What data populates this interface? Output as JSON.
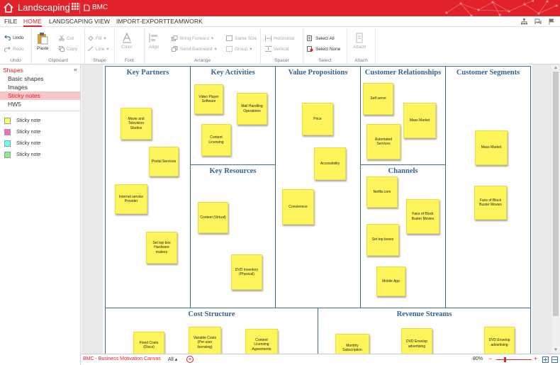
{
  "app": {
    "title": "Landscaping",
    "document": "BMC"
  },
  "menu": {
    "tabs": [
      "FILE",
      "HOME",
      "LANDSCAPING",
      "VIEW",
      "IMPORT-EXPORT",
      "TEAMWORK"
    ],
    "active": "HOME"
  },
  "ribbon": {
    "undo": "Undo",
    "redo": "Redo",
    "undo_group": "Undo",
    "paste": "Paste",
    "cut": "Cut",
    "copy": "Copy",
    "clipboard_group": "Clipboard",
    "fill": "Fill",
    "line": "Line",
    "shape_group": "Shape",
    "color": "Color",
    "font_group": "Font",
    "align": "Align",
    "bring_forward": "Bring Forward",
    "send_backward": "Send Backward",
    "same_size": "Same Size",
    "group": "Group",
    "arrange_group": "Arrange",
    "horizontal": "Horizontal",
    "vertical": "Vertical",
    "spacer_group": "Spacer",
    "select_all": "Select All",
    "select_none": "Select None",
    "select_group": "Select",
    "attach": "Attach",
    "attach_group": "Attach"
  },
  "sidebar": {
    "header": "Shapes",
    "collapse": "«",
    "categories": [
      "Basic shapes",
      "Images",
      "Sticky notes",
      "HW5"
    ],
    "selected": "Sticky notes",
    "items": [
      {
        "label": "Sticky note",
        "color": "#ffff66"
      },
      {
        "label": "Sticky note",
        "color": "#ff66cc"
      },
      {
        "label": "Sticky note",
        "color": "#66ffff"
      },
      {
        "label": "Sticky note",
        "color": "#88ee88"
      }
    ]
  },
  "canvas": {
    "titles": {
      "partners": "Key Partners",
      "activities": "Key Activities",
      "resources": "Key Resources",
      "value": "Value Propositions",
      "relationships": "Customer Relationships",
      "channels": "Channels",
      "segments": "Customer Segments",
      "cost": "Cost Structure",
      "revenue": "Revenue Streams"
    },
    "notes": [
      "Movie and Television Studios",
      "Postal Services",
      "Internet service Provider",
      "Set top box Hardware makers",
      "Video Player Software",
      "Mail Handling Operations",
      "Content Licensing",
      "Content (Virtual)",
      "DVD Inventory (Physical)",
      "Price",
      "Accessibility",
      "Conviennce",
      "Self serve",
      "Automated Services",
      "Mass Market",
      "Netflix.com",
      "Fans of Block Buster Movies",
      "Set top boxes",
      "Mobile App",
      "Mass Market",
      "Fans of Block Buster Movies",
      "Fixed Costs (Discs)",
      "Variable Costs (Per user licensing)",
      "Content Licensing Agreements",
      "Monthly Subscription",
      "DVD Envelop advertising",
      "DVD Envelop advertising"
    ]
  },
  "status": {
    "page": "BMC - Business Motivation Canvas",
    "filter": "All",
    "zoom": "80%"
  },
  "colors": {
    "accent": "#e2222b",
    "note": "#fdf55b",
    "frame": "#3c6d9a"
  }
}
